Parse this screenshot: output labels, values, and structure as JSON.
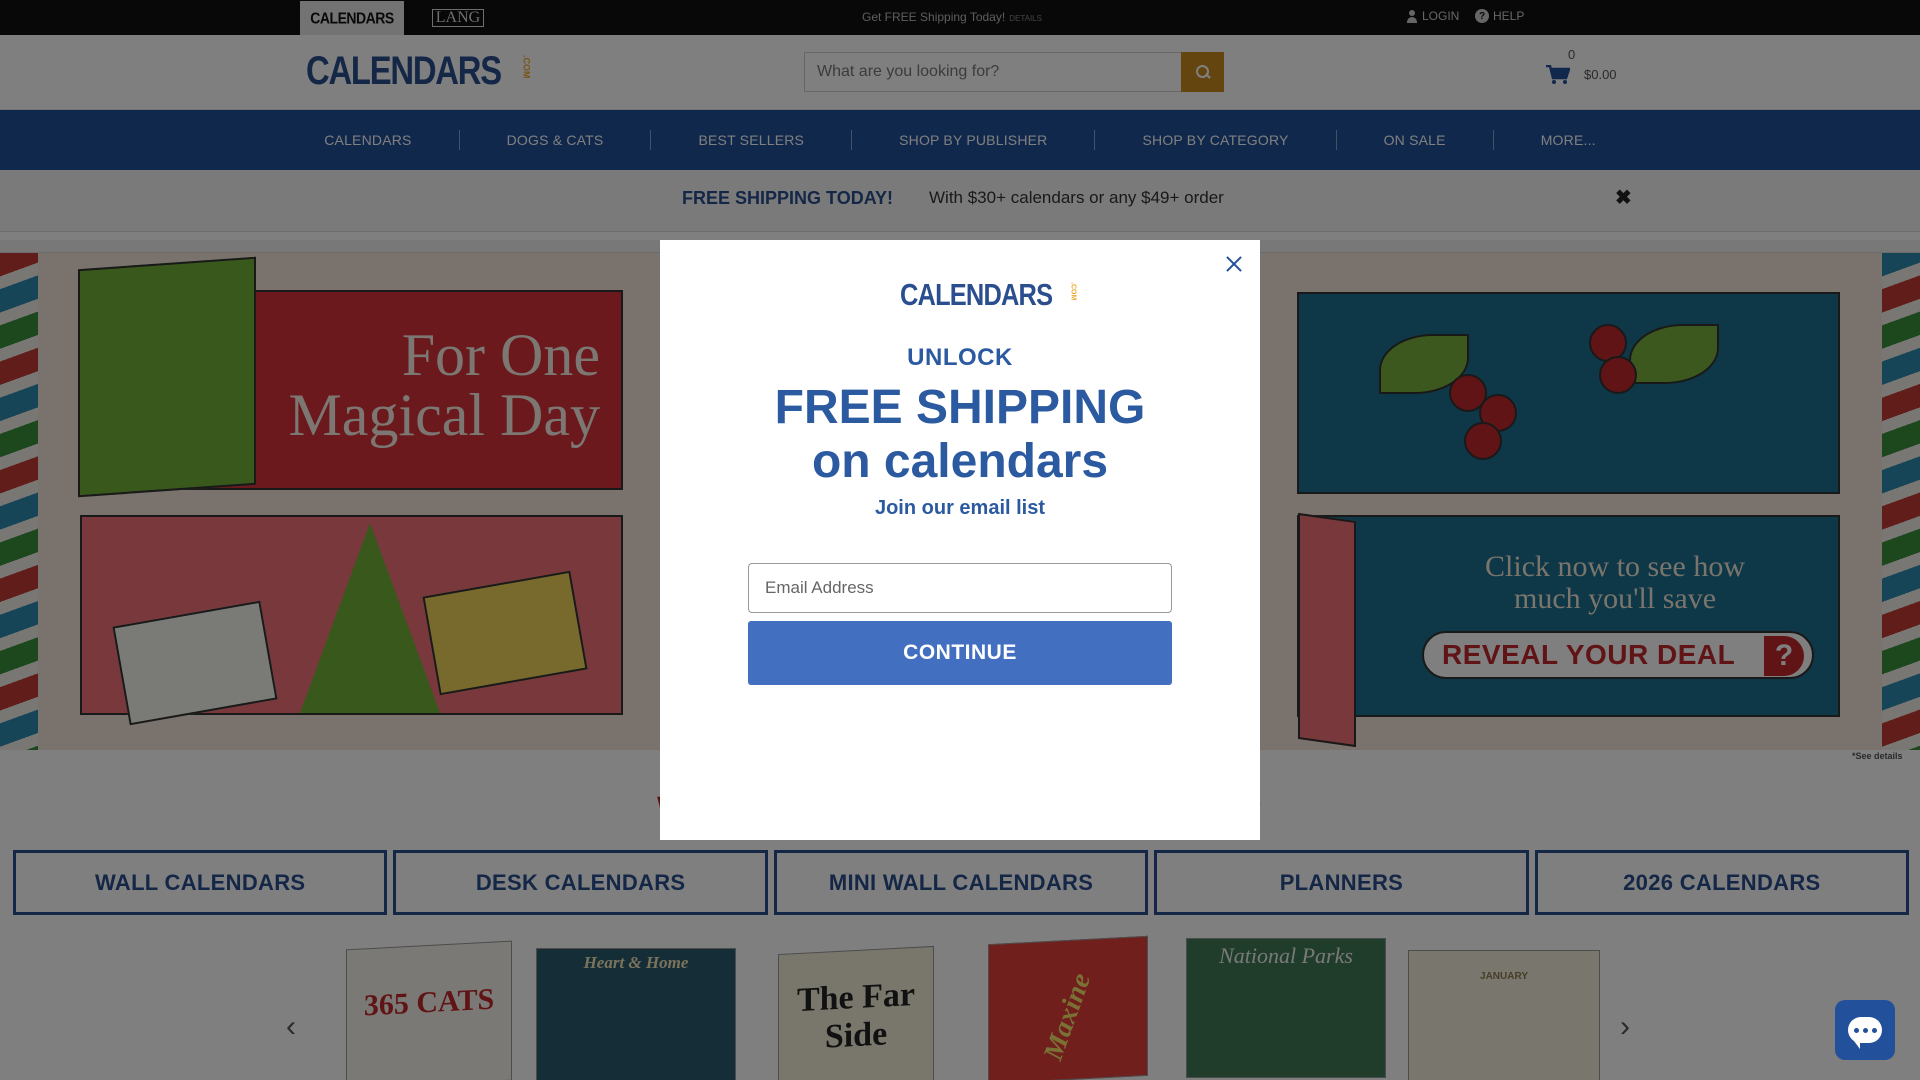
{
  "topbar": {
    "brand_calendars": "CALENDARS",
    "brand_lang": "LANG",
    "promo": "Get FREE Shipping Today!",
    "promo_details": "DETAILS",
    "login": "LOGIN",
    "help": "HELP"
  },
  "header": {
    "logo_word": "CALENDARS",
    "logo_com": ".COM",
    "search_placeholder": "What are you looking for?",
    "cart_count": "0",
    "cart_total": "$0.00"
  },
  "nav": {
    "items": [
      "CALENDARS",
      "DOGS & CATS",
      "BEST SELLERS",
      "SHOP BY PUBLISHER",
      "SHOP BY CATEGORY",
      "ON SALE",
      "MORE..."
    ]
  },
  "shipbar": {
    "strong": "FREE SHIPPING TODAY!",
    "text": "With $30+ calendars or any $49+ order",
    "close": "✖"
  },
  "hero": {
    "headline": "For One Magical Day",
    "sub": "Click now to see how much you'll save",
    "deal_button": "REVEAL YOUR DEAL",
    "deal_q": "?",
    "see_details": "*See details"
  },
  "section": {
    "heading": "WHA                                        AY?"
  },
  "categories": [
    "WALL CALENDARS",
    "DESK CALENDARS",
    "MINI WALL CALENDARS",
    "PLANNERS",
    "2026 CALENDARS"
  ],
  "products": [
    {
      "title": "365 CATS"
    },
    {
      "title": "Heart & Home"
    },
    {
      "title": "The Far Side"
    },
    {
      "title": "Maxine"
    },
    {
      "title": "National Parks"
    },
    {
      "title": "JANUARY"
    }
  ],
  "carousel": {
    "prev": "‹",
    "next": "›"
  },
  "modal": {
    "logo_word": "CALENDARS",
    "logo_com": ".COM",
    "unlock": "UNLOCK",
    "big_line1": "FREE SHIPPING",
    "big_line2": "on calendars",
    "join": "Join our email list",
    "email_placeholder": "Email Address",
    "continue": "CONTINUE"
  },
  "colors": {
    "brand_blue": "#23509a",
    "modal_blue": "#2b5aa0",
    "button_blue": "#426fc0",
    "accent_red": "#b31e2b",
    "search_gold": "#c9891f"
  }
}
